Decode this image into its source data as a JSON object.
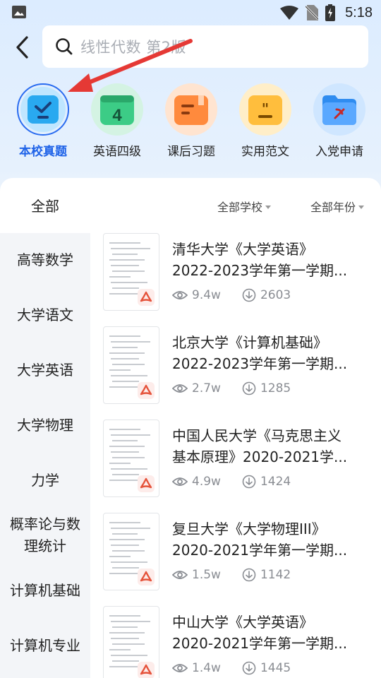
{
  "status_bar": {
    "time": "5:18"
  },
  "search": {
    "placeholder": "线性代数 第2版"
  },
  "categories": [
    {
      "label": "本校真题",
      "active": true,
      "color": "#43aaf5"
    },
    {
      "label": "英语四级",
      "active": false,
      "color": "#3dc684"
    },
    {
      "label": "课后习题",
      "active": false,
      "color": "#ff8a3d"
    },
    {
      "label": "实用范文",
      "active": false,
      "color": "#ffb33a"
    },
    {
      "label": "入党申请",
      "active": false,
      "color": "#2f8cf0"
    }
  ],
  "filters": {
    "all": "全部",
    "school": "全部学校",
    "year": "全部年份"
  },
  "side_nav": [
    "高等数学",
    "大学语文",
    "大学英语",
    "大学物理",
    "力学",
    "概率论与数理统计",
    "计算机基础",
    "计算机专业"
  ],
  "documents": [
    {
      "title_line1": "清华大学《大学英语》",
      "title_line2": "2022-2023学年第一学期...",
      "views": "9.4w",
      "downloads": "2603"
    },
    {
      "title_line1": "北京大学《计算机基础》",
      "title_line2": "2022-2023学年第一学期...",
      "views": "2.7w",
      "downloads": "1285"
    },
    {
      "title_line1": "中国人民大学《马克思主义",
      "title_line2": "基本原理》2020-2021学...",
      "views": "4.9w",
      "downloads": "1424"
    },
    {
      "title_line1": "复旦大学《大学物理III》",
      "title_line2": "2020-2021学年第一学期...",
      "views": "1.5w",
      "downloads": "1142"
    },
    {
      "title_line1": "中山大学《大学英语》",
      "title_line2": "2020-2021学年第一学期...",
      "views": "1.4w",
      "downloads": "1445"
    }
  ],
  "colors": {
    "accent": "#1f63e8",
    "arrow": "#e53935"
  }
}
